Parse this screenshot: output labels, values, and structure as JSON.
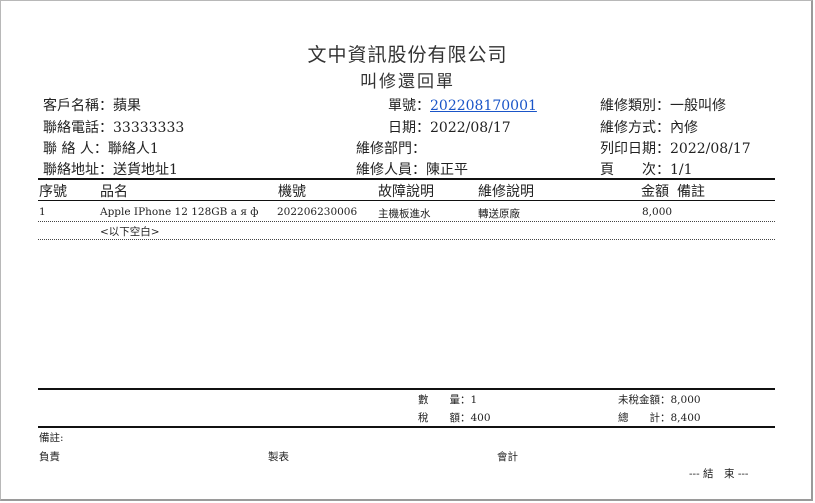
{
  "company_name": "文中資訊股份有限公司",
  "doc_title": "叫修還回單",
  "header": {
    "customer_label": "客戶名稱：",
    "customer_value": "蘋果",
    "phone_label": "聯絡電話：",
    "phone_value": "33333333",
    "contact_label": "聯 絡 人：",
    "contact_value": "聯絡人1",
    "address_label": "聯絡地址：",
    "address_value": "送貨地址1",
    "order_label": "單號：",
    "order_value": "202208170001",
    "date_label": "日期：",
    "date_value": "2022/08/17",
    "dept_label": "維修部門：",
    "dept_value": "",
    "staff_label": "維修人員：",
    "staff_value": "陳正平",
    "repair_type_label": "維修類別：",
    "repair_type_value": "一般叫修",
    "repair_method_label": "維修方式：",
    "repair_method_value": "內修",
    "print_date_label": "列印日期：",
    "print_date_value": "2022/08/17",
    "page_label": "頁　　次：",
    "page_value": "1/1"
  },
  "table": {
    "columns": [
      "序號",
      "品名",
      "機號",
      "故障說明",
      "維修說明",
      "金額",
      "備註"
    ],
    "rows": [
      [
        "1",
        "Apple IPhone 12 128GB a я ф",
        "202206230006",
        "主機板進水",
        "轉送原廠",
        "8,000",
        ""
      ]
    ],
    "blank_note": "<以下空白>"
  },
  "summary": {
    "qty_label": "數　　量：",
    "qty_value": "1",
    "tax_label": "稅　　額：",
    "tax_value": "400",
    "pretax_label": "未稅金額：",
    "pretax_value": "8,000",
    "total_label": "總　　計：",
    "total_value": "8,400"
  },
  "footer": {
    "remarks_label": "備註:",
    "responsible_label": "負責",
    "prepared_label": "製表",
    "accounting_label": "會計",
    "end_label": "--- 結　束 ---"
  }
}
